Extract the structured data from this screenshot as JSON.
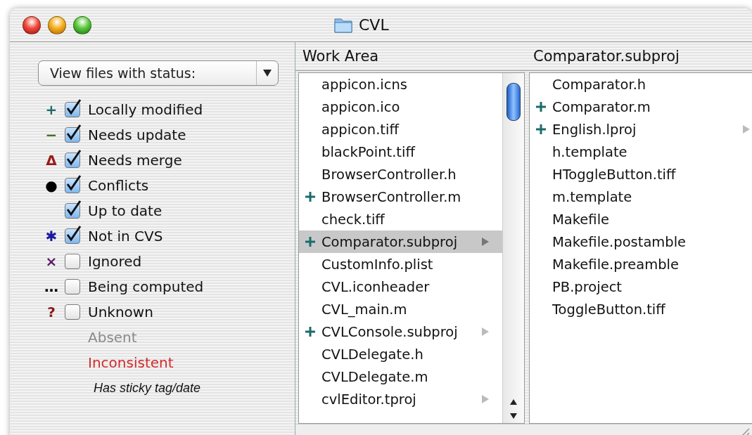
{
  "window": {
    "title": "CVL"
  },
  "filter": {
    "label": "View files with status:"
  },
  "legend": [
    {
      "kind": "checkbox",
      "marker": "+",
      "color": "#1a6b6b",
      "label": "Locally modified",
      "checked": true
    },
    {
      "kind": "checkbox",
      "marker": "−",
      "color": "#4a6a1a",
      "label": "Needs update",
      "checked": true
    },
    {
      "kind": "checkbox",
      "marker": "Δ",
      "color": "#9a1a1a",
      "label": "Needs merge",
      "checked": true
    },
    {
      "kind": "checkbox",
      "marker": "●",
      "color": "#000000",
      "label": "Conflicts",
      "checked": true
    },
    {
      "kind": "checkbox",
      "label": "Up to date",
      "checked": true
    },
    {
      "kind": "checkbox",
      "marker": "✱",
      "color": "#1a1aa0",
      "label": "Not in CVS",
      "checked": true
    },
    {
      "kind": "checkbox",
      "marker": "×",
      "color": "#5a1a6a",
      "label": "Ignored",
      "checked": false
    },
    {
      "kind": "checkbox",
      "marker": "…",
      "color": "#000000",
      "label": "Being computed",
      "checked": false
    },
    {
      "kind": "checkbox",
      "marker": "?",
      "color": "#8a1a1a",
      "label": "Unknown",
      "checked": false
    },
    {
      "kind": "plain",
      "label": "Absent",
      "color": "#8a8a8a"
    },
    {
      "kind": "plain",
      "label": "Inconsistent",
      "color": "#d42a2a"
    },
    {
      "kind": "italic",
      "label": "Has sticky tag/date"
    }
  ],
  "columns": [
    {
      "title": "Work Area",
      "scrollbar": true,
      "rows": [
        {
          "name": "appicon.icns",
          "kind": "plain",
          "folder": false,
          "selected": false
        },
        {
          "name": "appicon.ico",
          "kind": "plain",
          "folder": false,
          "selected": false
        },
        {
          "name": "appicon.tiff",
          "kind": "plain",
          "folder": false,
          "selected": false
        },
        {
          "name": "blackPoint.tiff",
          "kind": "plain",
          "folder": false,
          "selected": false
        },
        {
          "name": "BrowserController.h",
          "kind": "plain",
          "folder": false,
          "selected": false
        },
        {
          "name": "BrowserController.m",
          "kind": "modified",
          "folder": false,
          "selected": false
        },
        {
          "name": "check.tiff",
          "kind": "plain",
          "folder": false,
          "selected": false
        },
        {
          "name": "Comparator.subproj",
          "kind": "modified",
          "folder": true,
          "selected": true
        },
        {
          "name": "CustomInfo.plist",
          "kind": "plain",
          "folder": false,
          "selected": false
        },
        {
          "name": "CVL.iconheader",
          "kind": "plain",
          "folder": false,
          "selected": false
        },
        {
          "name": "CVL_main.m",
          "kind": "plain",
          "folder": false,
          "selected": false
        },
        {
          "name": "CVLConsole.subproj",
          "kind": "modified",
          "folder": true,
          "selected": false
        },
        {
          "name": "CVLDelegate.h",
          "kind": "plain",
          "folder": false,
          "selected": false
        },
        {
          "name": "CVLDelegate.m",
          "kind": "plain",
          "folder": false,
          "selected": false
        },
        {
          "name": "cvlEditor.tproj",
          "kind": "plain",
          "folder": true,
          "selected": false
        }
      ]
    },
    {
      "title": "Comparator.subproj",
      "scrollbar": false,
      "rows": [
        {
          "name": "Comparator.h",
          "kind": "plain",
          "folder": false,
          "selected": false
        },
        {
          "name": "Comparator.m",
          "kind": "modified",
          "folder": false,
          "selected": false
        },
        {
          "name": "English.lproj",
          "kind": "modified",
          "folder": true,
          "selected": false
        },
        {
          "name": "h.template",
          "kind": "plain",
          "folder": false,
          "selected": false
        },
        {
          "name": "HToggleButton.tiff",
          "kind": "plain",
          "folder": false,
          "selected": false
        },
        {
          "name": "m.template",
          "kind": "plain",
          "folder": false,
          "selected": false
        },
        {
          "name": "Makefile",
          "kind": "plain",
          "folder": false,
          "selected": false
        },
        {
          "name": "Makefile.postamble",
          "kind": "plain",
          "folder": false,
          "selected": false
        },
        {
          "name": "Makefile.preamble",
          "kind": "plain",
          "folder": false,
          "selected": false
        },
        {
          "name": "PB.project",
          "kind": "plain",
          "folder": false,
          "selected": false
        },
        {
          "name": "ToggleButton.tiff",
          "kind": "plain",
          "folder": false,
          "selected": false
        }
      ]
    }
  ]
}
